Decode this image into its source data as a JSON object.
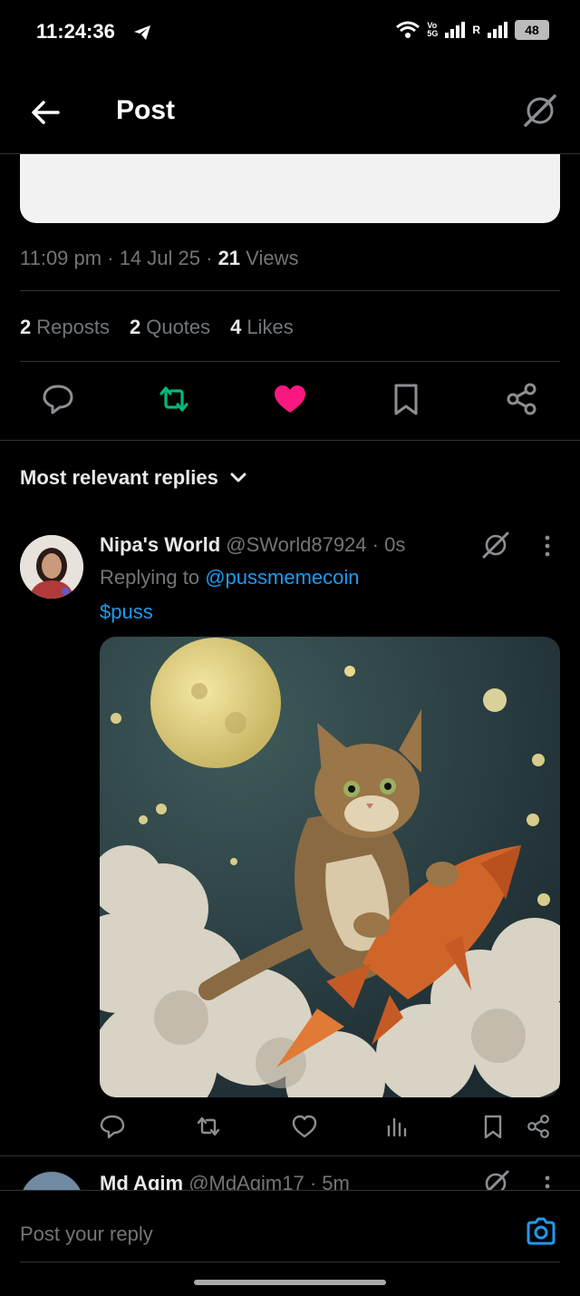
{
  "status_bar": {
    "time": "11:24:36",
    "volte_top": "Vo",
    "volte_bottom": "5G",
    "roaming": "R",
    "battery": "48"
  },
  "header": {
    "title": "Post"
  },
  "post": {
    "time": "11:09 pm",
    "date": "14 Jul 25",
    "views_count": "21",
    "views_label": "Views",
    "reposts_count": "2",
    "reposts_label": "Reposts",
    "quotes_count": "2",
    "quotes_label": "Quotes",
    "likes_count": "4",
    "likes_label": "Likes"
  },
  "replies_sort": {
    "label": "Most relevant replies"
  },
  "replies": [
    {
      "name": "Nipa's World",
      "handle": "@SWorld87924",
      "time": "0s",
      "replying_prefix": "Replying to",
      "replying_to": "@pussmemecoin",
      "text": "$puss"
    },
    {
      "name": "Md Agim",
      "handle": "@MdAgim17",
      "time": "5m"
    }
  ],
  "composer": {
    "placeholder": "Post your reply"
  },
  "colors": {
    "accent": "#1d9bf0",
    "repost_active": "#00ba7c",
    "like_active": "#f91880",
    "muted": "#71767b"
  }
}
